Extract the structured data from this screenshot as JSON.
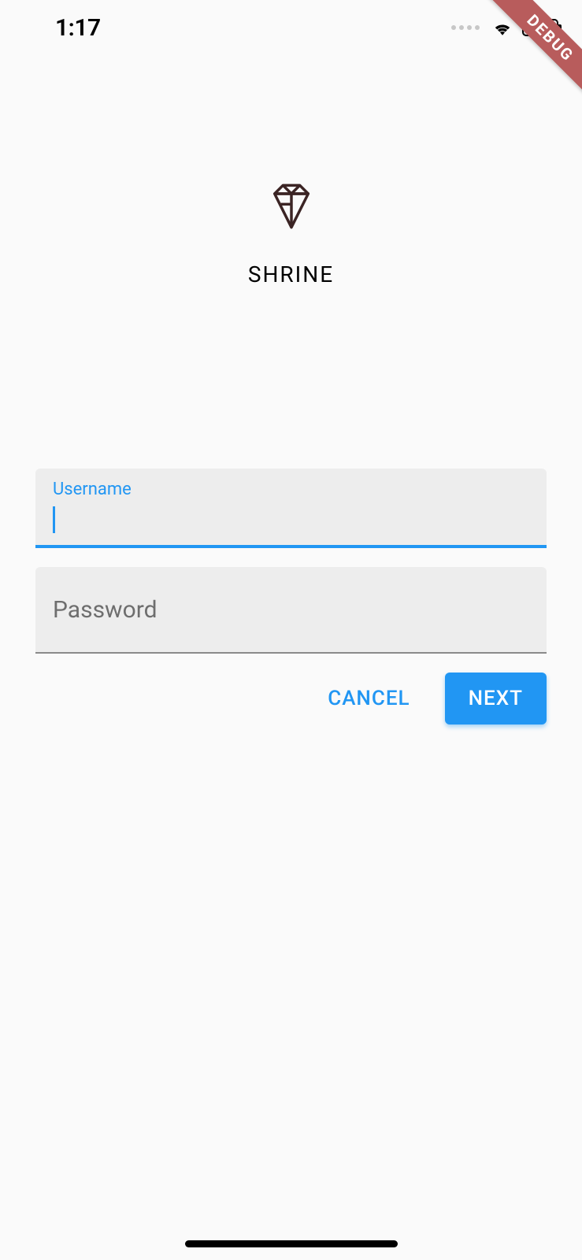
{
  "status_bar": {
    "time": "1:17"
  },
  "debug_ribbon": "DEBUG",
  "brand": {
    "title": "SHRINE",
    "logo_color": "#3b2424"
  },
  "fields": {
    "username": {
      "label": "Username",
      "value": ""
    },
    "password": {
      "label": "Password",
      "value": ""
    }
  },
  "buttons": {
    "cancel": "CANCEL",
    "next": "NEXT"
  },
  "colors": {
    "accent": "#2196f3",
    "field_bg": "#ededed",
    "page_bg": "#fafafa"
  }
}
